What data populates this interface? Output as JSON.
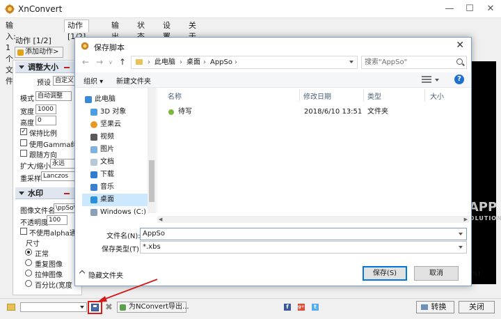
{
  "app": {
    "title": "XnConvert"
  },
  "tabs": [
    "输入: 1个文件",
    "动作 [1/2]",
    "输出",
    "状态",
    "设置",
    "关于"
  ],
  "actions_panel": {
    "subtitle": "动作 [1/2]",
    "add_action_label": "添加动作>",
    "resize_section": {
      "title": "调整大小",
      "preset_label": "预设",
      "preset_value": "自定义",
      "mode_label": "模式",
      "mode_value": "自动调整",
      "width_label": "宽度",
      "width_value": "1000",
      "height_label": "高度",
      "height_value": "0",
      "keep_ratio_label": "保持比例",
      "keep_ratio_checked": true,
      "gamma_label": "使用Gamma纠正",
      "follow_orientation_label": "跟随方向",
      "enlarge_label": "扩大/缩小",
      "enlarge_value": "永远",
      "resample_label": "重采样",
      "resample_value": "Lanczos"
    },
    "watermark_section": {
      "title": "水印",
      "image_file_label": "图像文件名",
      "image_file_value": "\\ppSo\\",
      "opacity_label": "不透明度",
      "opacity_value": "100",
      "no_alpha_label": "不使用alpha通道",
      "size_label": "尺寸",
      "size_options": [
        "正常",
        "重复图像",
        "拉伸图像",
        "百分比(宽度"
      ]
    }
  },
  "preview": {
    "percent_text": "0%]"
  },
  "watermark_text": {
    "big": "APP",
    "small": "SOLUTION"
  },
  "bottom_bar": {
    "export_label": "为NConvert导出...",
    "convert_label": "转换",
    "close_label": "关闭",
    "social": [
      "f",
      "g+",
      "t"
    ]
  },
  "dialog": {
    "title": "保存脚本",
    "breadcrumbs": [
      "此电脑",
      "桌面",
      "AppSo"
    ],
    "search_placeholder": "搜索\"AppSo\"",
    "organize_label": "组织 ▾",
    "new_folder_label": "新建文件夹",
    "tree": [
      {
        "label": "此电脑",
        "icon": "computer-icon",
        "selected": false
      },
      {
        "label": "3D 对象",
        "icon": "3d-objects-icon",
        "selected": false
      },
      {
        "label": "坚果云",
        "icon": "nutstore-icon",
        "selected": false
      },
      {
        "label": "视频",
        "icon": "video-icon",
        "selected": false
      },
      {
        "label": "图片",
        "icon": "pictures-icon",
        "selected": false
      },
      {
        "label": "文档",
        "icon": "documents-icon",
        "selected": false
      },
      {
        "label": "下载",
        "icon": "downloads-icon",
        "selected": false
      },
      {
        "label": "音乐",
        "icon": "music-icon",
        "selected": false
      },
      {
        "label": "桌面",
        "icon": "desktop-icon",
        "selected": true
      },
      {
        "label": "Windows (C:)",
        "icon": "drive-icon",
        "selected": false
      }
    ],
    "columns": [
      "名称",
      "修改日期",
      "类型",
      "大小"
    ],
    "files": [
      {
        "name": "待写",
        "modified": "2018/6/10 13:51",
        "type": "文件夹",
        "size": ""
      }
    ],
    "filename_label": "文件名(N):",
    "filename_value": "AppSo",
    "filetype_label": "保存类型(T):",
    "filetype_value": "*.xbs",
    "hide_folders_label": "隐藏文件夹",
    "save_label": "保存(S)",
    "cancel_label": "取消"
  },
  "colors": {
    "annotation_red": "#d41c1c",
    "selection_blue": "#cce8ff",
    "accent_blue": "#0078d7"
  }
}
